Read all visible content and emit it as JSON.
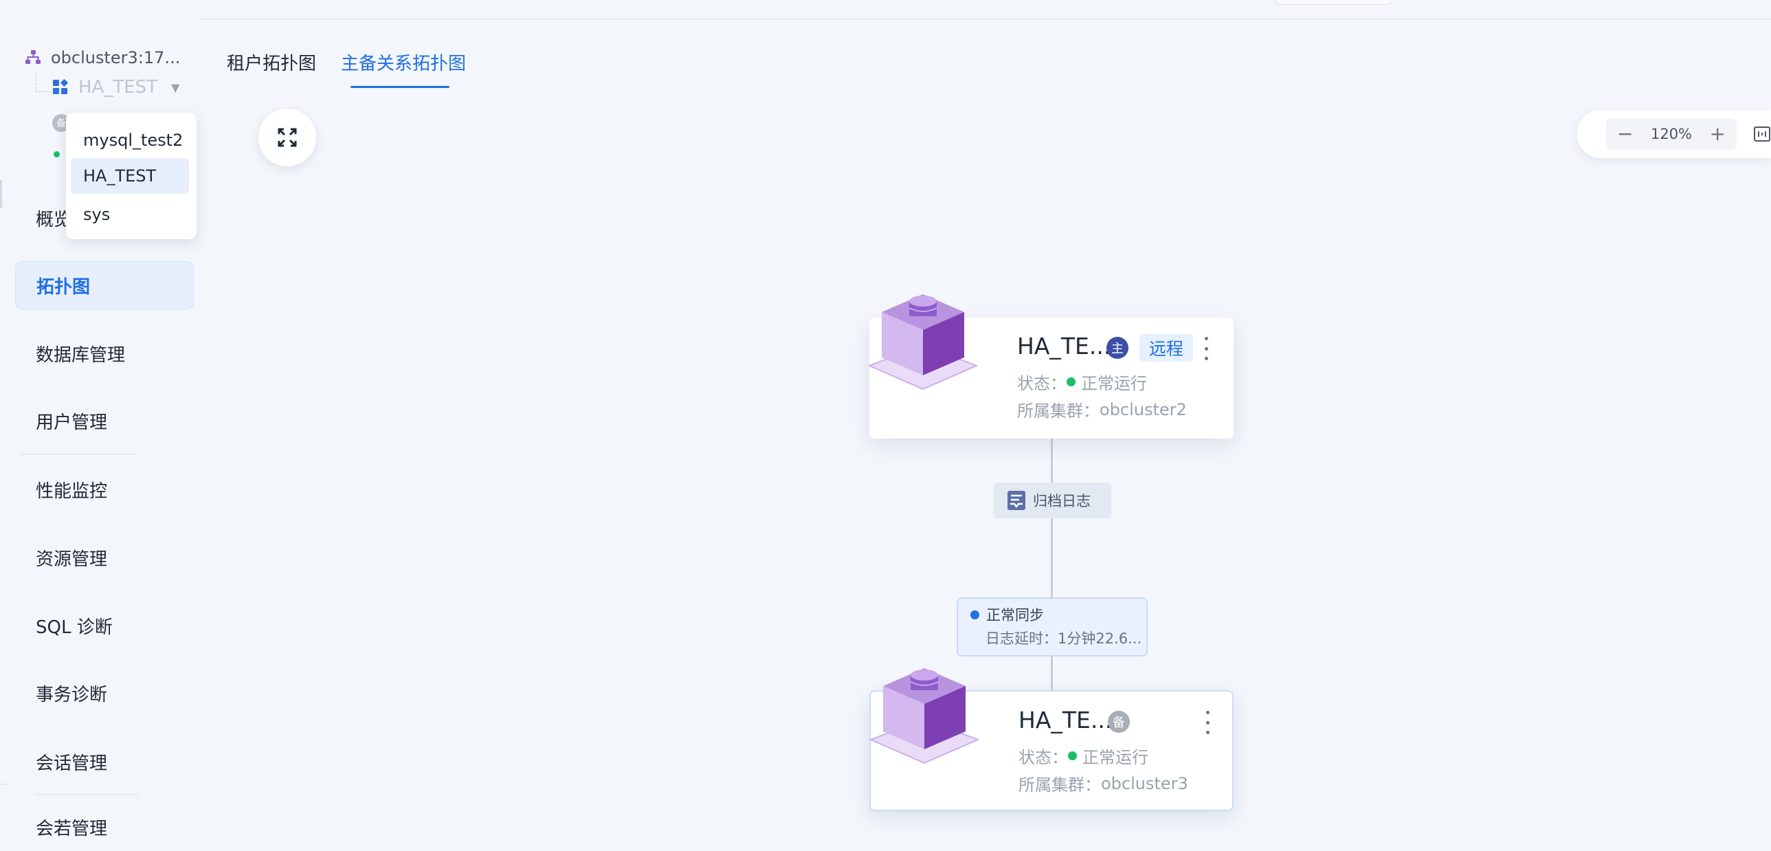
{
  "sidebar": {
    "cluster_name": "obcluster3:17...",
    "tenant_name": "HA_TEST",
    "standby_badge": "备",
    "menu": [
      {
        "label": "概览"
      },
      {
        "label": "拓扑图"
      },
      {
        "label": "数据库管理"
      },
      {
        "label": "用户管理"
      },
      {
        "label": "性能监控"
      },
      {
        "label": "资源管理"
      },
      {
        "label": "SQL 诊断"
      },
      {
        "label": "事务诊断"
      },
      {
        "label": "会话管理"
      },
      {
        "label": "会若管理"
      }
    ]
  },
  "tenant_dropdown": {
    "options": [
      "mysql_test2",
      "HA_TEST",
      "sys"
    ],
    "selected": "HA_TEST"
  },
  "tabs": [
    {
      "label": "租户拓扑图",
      "active": false
    },
    {
      "label": "主备关系拓扑图",
      "active": true
    }
  ],
  "zoom": {
    "value": "120%",
    "minus": "−",
    "plus": "+"
  },
  "topology": {
    "primary": {
      "name": "HA_TE...",
      "role": "主",
      "tag": "远程",
      "status_label": "状态：",
      "status_value": "正常运行",
      "cluster_label": "所属集群：",
      "cluster_value": "obcluster2"
    },
    "archive_log": "归档日志",
    "sync": {
      "status": "正常同步",
      "delay": "日志延时：1分钟22.6..."
    },
    "standby": {
      "name": "HA_TE...",
      "role": "备",
      "status_label": "状态：",
      "status_value": "正常运行",
      "cluster_label": "所属集群：",
      "cluster_value": "obcluster3"
    }
  },
  "colors": {
    "accent": "#1f6fe5",
    "running": "#19be6b",
    "primary_badge": "#3d4ea8",
    "node_purple": "#8e5cc9"
  }
}
